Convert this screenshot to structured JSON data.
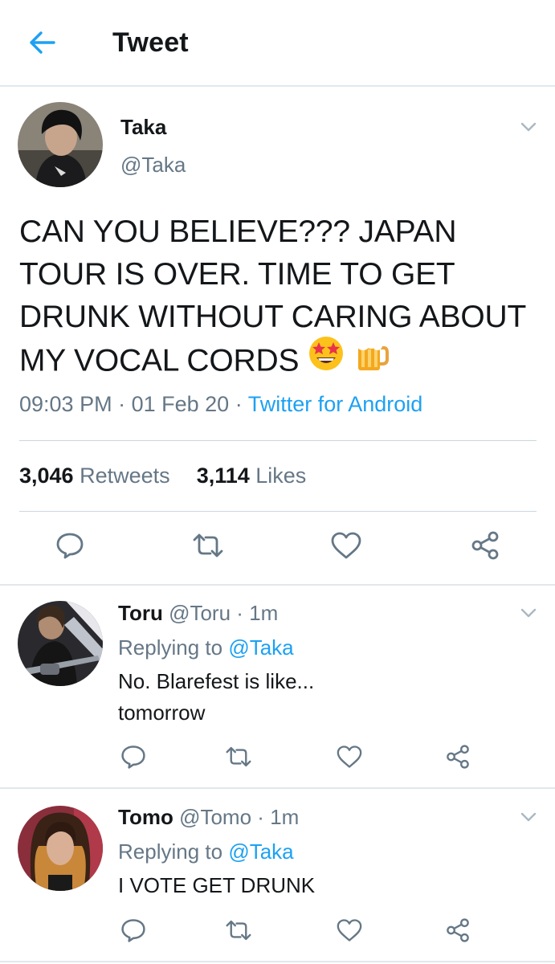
{
  "header": {
    "title": "Tweet"
  },
  "tweet": {
    "name": "Taka",
    "handle": "@Taka",
    "text_lines": [
      "CAN YOU BELIEVE??? JAPAN",
      "TOUR IS OVER. TIME TO GET",
      "DRUNK WITHOUT CARING ABOUT",
      "MY VOCAL CORDS"
    ],
    "time": "09:03 PM",
    "date": "01 Feb 20",
    "source": "Twitter for Android",
    "retweets_count": "3,046",
    "retweets_label": "Retweets",
    "likes_count": "3,114",
    "likes_label": "Likes"
  },
  "replies": [
    {
      "name": "Toru",
      "handle": "@Toru",
      "time": "1m",
      "replying_label": "Replying to",
      "replying_to": "@Taka",
      "text_lines": [
        "No. Blarefest is like...",
        "tomorrow"
      ]
    },
    {
      "name": "Tomo",
      "handle": "@Tomo",
      "time": "1m",
      "replying_label": "Replying to",
      "replying_to": "@Taka",
      "text_lines": [
        "I VOTE GET DRUNK"
      ]
    }
  ],
  "icons": {
    "back": "arrow-left-icon",
    "more": "chevron-down-icon",
    "reply": "speech-bubble-icon",
    "retweet": "retweet-icon",
    "like": "heart-icon",
    "share": "share-icon",
    "emoji_1": "star-struck-emoji",
    "emoji_2": "beer-mug-emoji"
  },
  "colors": {
    "accent": "#1da1f2",
    "secondary_text": "#657786",
    "divider": "#e1e8ed"
  }
}
